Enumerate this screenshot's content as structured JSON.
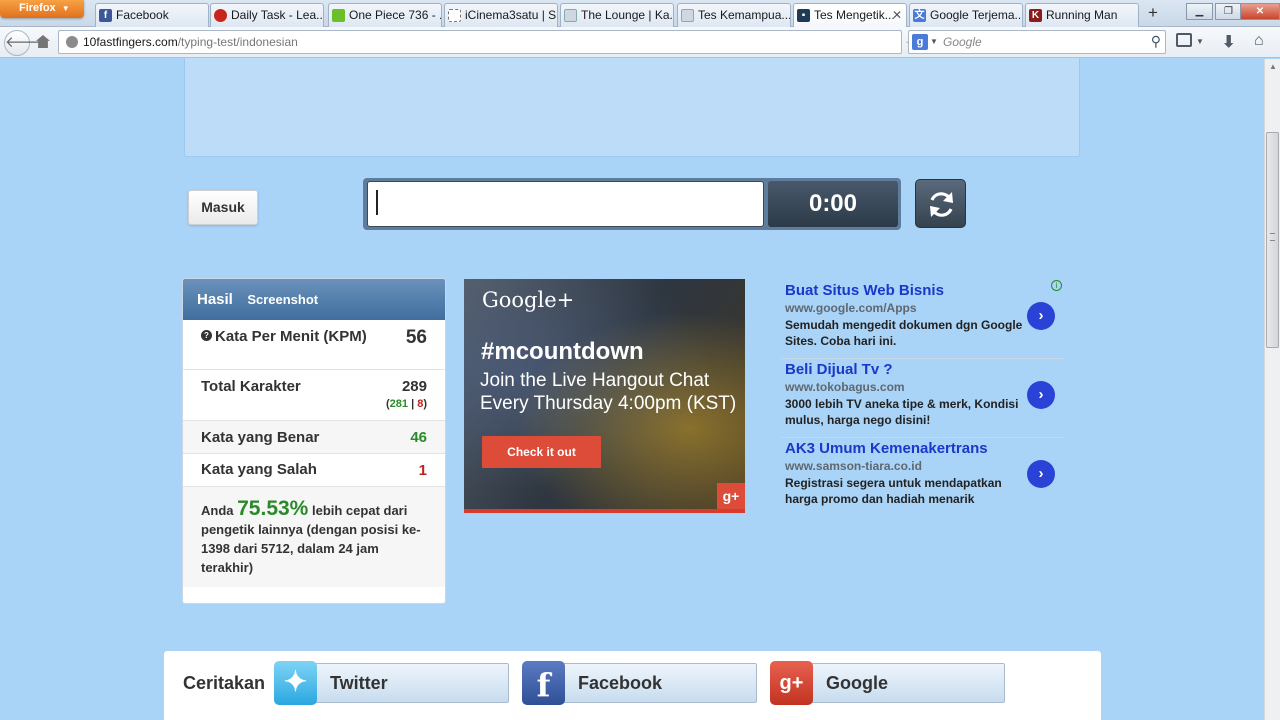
{
  "browser": {
    "menu_label": "Firefox",
    "tabs": [
      {
        "label": "Facebook",
        "favicon": "facebook-icon"
      },
      {
        "label": "Daily Task - Lea...",
        "favicon": "bullseye-icon"
      },
      {
        "label": "One Piece 736 - ...",
        "favicon": "leaf-icon"
      },
      {
        "label": "iCinema3satu | S...",
        "favicon": "dashed-square-icon"
      },
      {
        "label": "The Lounge | Ka...",
        "favicon": "page-icon"
      },
      {
        "label": "Tes Kemampua...",
        "favicon": "page-icon"
      },
      {
        "label": "Tes Mengetik...",
        "favicon": "10fastfingers-icon",
        "active": true
      },
      {
        "label": "Google Terjema...",
        "favicon": "google-translate-icon"
      },
      {
        "label": "Running Man",
        "favicon": "k-icon"
      }
    ],
    "new_tab_symbol": "+",
    "url_domain": "10fastfingers.com",
    "url_path": "/typing-test/indonesian",
    "search_placeholder": "Google",
    "search_engine_letter": "g",
    "colors": {
      "firefox_orange": "#e87d24",
      "accent": "#3f6e9e"
    }
  },
  "page": {
    "login_label": "Masuk",
    "typing_input_value": "",
    "timer": "0:00",
    "result": {
      "tab_result": "Hasil",
      "tab_screenshot": "Screenshot",
      "wpm_label": "Kata Per Menit (KPM)",
      "wpm_value": "56",
      "chars_label": "Total Karakter",
      "chars_value": "289",
      "chars_correct": "281",
      "chars_separator": "|",
      "chars_wrong": "8",
      "correct_words_label": "Kata yang Benar",
      "correct_words_value": "46",
      "wrong_words_label": "Kata yang Salah",
      "wrong_words_value": "1",
      "summary_prefix": "Anda",
      "summary_percent": "75.53%",
      "summary_suffix": "lebih cepat dari pengetik lainnya (dengan posisi ke-1398 dari 5712, dalam 24 jam terakhir)"
    },
    "gplus_ad": {
      "logo": "Google+",
      "tag": "#mcountdown",
      "line1": "Join the Live Hangout Chat",
      "line2": "Every Thursday  4:00pm (KST)",
      "cta": "Check it out",
      "badge": "g+"
    },
    "text_ads": [
      {
        "title": "Buat Situs Web Bisnis",
        "url": "www.google.com/Apps",
        "desc": "Semudah mengedit dokumen dgn Google Sites. Coba hari ini."
      },
      {
        "title": "Beli Dijual Tv ?",
        "url": "www.tokobagus.com",
        "desc": "3000 lebih TV aneka tipe & merk, Kondisi mulus, harga nego disini!"
      },
      {
        "title": "AK3 Umum Kemenakertrans",
        "url": "www.samson-tiara.co.id",
        "desc": "Registrasi segera untuk mendapatkan harga promo dan hadiah menarik"
      }
    ],
    "share": {
      "label": "Ceritakan",
      "twitter": "Twitter",
      "facebook": "Facebook",
      "google": "Google"
    }
  }
}
